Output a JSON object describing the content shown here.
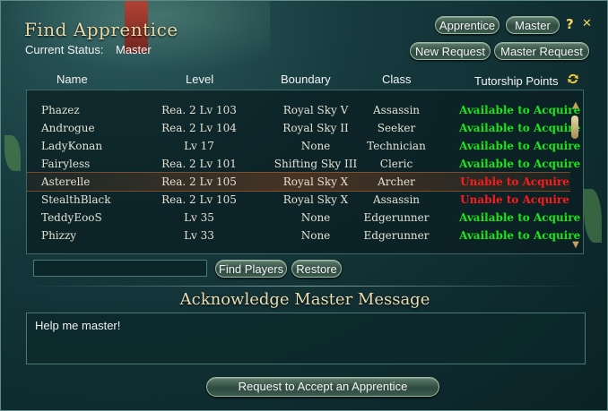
{
  "window": {
    "title": "Find Apprentice",
    "status_label": "Current Status:",
    "status_value": "Master"
  },
  "top_buttons": {
    "apprentice": "Apprentice",
    "master": "Master",
    "help": "?",
    "close": "✕",
    "new_request": "New Request",
    "master_request": "Master Request"
  },
  "columns": {
    "name": "Name",
    "level": "Level",
    "boundary": "Boundary",
    "class": "Class",
    "tutorship": "Tutorship Points"
  },
  "colors": {
    "available": "#19e619",
    "unable": "#ff1a1a"
  },
  "rows": [
    {
      "name": "Phazez",
      "level": "Rea. 2 Lv 103",
      "boundary": "Royal Sky V",
      "class": "Assassin",
      "tutorship": "Available to Acquire",
      "status": "available"
    },
    {
      "name": "Androgue",
      "level": "Rea. 2 Lv 104",
      "boundary": "Royal Sky II",
      "class": "Seeker",
      "tutorship": "Available to Acquire",
      "status": "available"
    },
    {
      "name": "LadyKonan",
      "level": "Lv 17",
      "boundary": "None",
      "class": "Technician",
      "tutorship": "Available to Acquire",
      "status": "available"
    },
    {
      "name": "Fairyless",
      "level": "Rea. 2 Lv 101",
      "boundary": "Shifting Sky III",
      "class": "Cleric",
      "tutorship": "Available to Acquire",
      "status": "available"
    },
    {
      "name": "Asterelle",
      "level": "Rea. 2 Lv 105",
      "boundary": "Royal Sky X",
      "class": "Archer",
      "tutorship": "Unable to Acquire",
      "status": "unable"
    },
    {
      "name": "StealthBlack",
      "level": "Rea. 2 Lv 105",
      "boundary": "Royal Sky X",
      "class": "Assassin",
      "tutorship": "Unable to Acquire",
      "status": "unable"
    },
    {
      "name": "TeddyEooS",
      "level": "Lv 35",
      "boundary": "None",
      "class": "Edgerunner",
      "tutorship": "Available to Acquire",
      "status": "available"
    },
    {
      "name": "Phizzy",
      "level": "Lv 33",
      "boundary": "None",
      "class": "Edgerunner",
      "tutorship": "Available to Acquire",
      "status": "available"
    }
  ],
  "search": {
    "value": "",
    "find_label": "Find Players",
    "restore_label": "Restore"
  },
  "message": {
    "title": "Acknowledge Master Message",
    "text": "Help me master!"
  },
  "footer": {
    "request_label": "Request to Accept an Apprentice"
  }
}
